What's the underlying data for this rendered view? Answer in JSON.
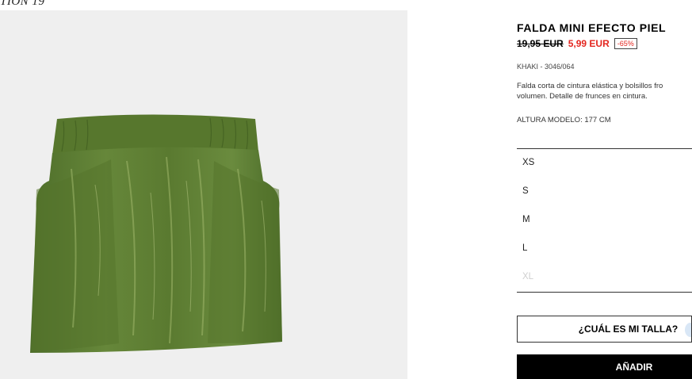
{
  "collection_label": "TION 19",
  "product": {
    "title": "FALDA MINI EFECTO PIEL",
    "old_price": "19,95 EUR",
    "new_price": "5,99 EUR",
    "discount": "-65%",
    "color_ref": "KHAKI - 3046/064",
    "description_line1": "Falda corta de cintura elástica y bolsillos fro",
    "description_line2": "volumen. Detalle de frunces en cintura.",
    "model_height": "ALTURA MODELO: 177 CM"
  },
  "sizes": [
    {
      "label": "XS",
      "available": true
    },
    {
      "label": "S",
      "available": true
    },
    {
      "label": "M",
      "available": true
    },
    {
      "label": "L",
      "available": true
    },
    {
      "label": "XL",
      "available": false
    }
  ],
  "buttons": {
    "size_guide": "¿CUÁL ES MI TALLA?",
    "add": "AÑADIR"
  },
  "colors": {
    "price_red": "#e4261f",
    "skirt_green": "#5f7f35",
    "image_bg": "#efefef"
  }
}
